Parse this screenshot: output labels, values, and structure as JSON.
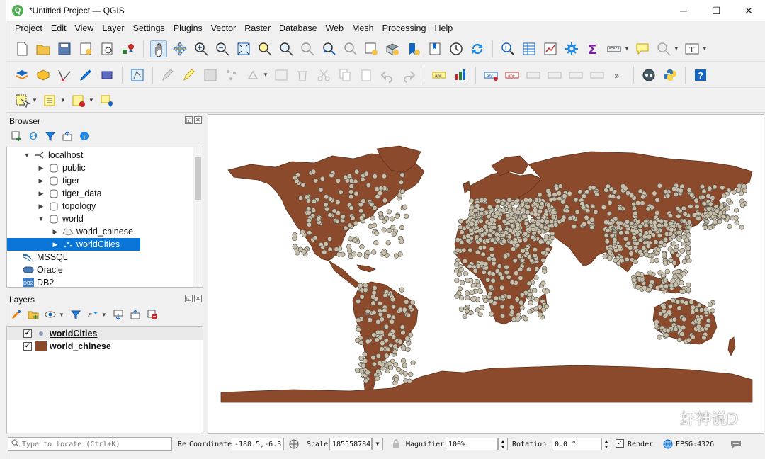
{
  "window": {
    "title": "*Untitled Project — QGIS",
    "minimize": "─",
    "maximize": "☐",
    "close": "✕"
  },
  "menu": [
    "Project",
    "Edit",
    "View",
    "Layer",
    "Settings",
    "Plugins",
    "Vector",
    "Raster",
    "Database",
    "Web",
    "Mesh",
    "Processing",
    "Help"
  ],
  "browser": {
    "title": "Browser",
    "tree": [
      {
        "label": "localhost",
        "icon": "postgres-connection-icon",
        "expanded": true
      },
      {
        "label": "public",
        "icon": "schema-icon"
      },
      {
        "label": "tiger",
        "icon": "schema-icon"
      },
      {
        "label": "tiger_data",
        "icon": "schema-icon"
      },
      {
        "label": "topology",
        "icon": "schema-icon"
      },
      {
        "label": "world",
        "icon": "schema-icon",
        "expanded": true
      },
      {
        "label": "world_chinese",
        "icon": "polygon-layer-icon"
      },
      {
        "label": "worldCities",
        "icon": "point-layer-icon",
        "selected": true
      },
      {
        "label": "MSSQL",
        "icon": "mssql-icon"
      },
      {
        "label": "Oracle",
        "icon": "oracle-icon"
      },
      {
        "label": "DB2",
        "icon": "db2-icon"
      }
    ]
  },
  "layers": {
    "title": "Layers",
    "items": [
      {
        "name": "worldCities",
        "visible": true,
        "symbol_color": "#8a9bb5"
      },
      {
        "name": "world_chinese",
        "visible": true,
        "symbol_color": "#8b4a2b"
      }
    ]
  },
  "map": {
    "land_color": "#8b4a2b",
    "city_color": "#c9bfa8",
    "watermark": "虾神说D"
  },
  "status": {
    "search_placeholder": "Type to locate (Ctrl+K)",
    "truncated_label": "Re",
    "coordinate_label": "Coordinate",
    "coordinate_value": "-188.5,-6.3",
    "scale_label": "Scale",
    "scale_value": "185558784",
    "magnifier_label": "Magnifier",
    "magnifier_value": "100%",
    "rotation_label": "Rotation",
    "rotation_value": "0.0 °",
    "render_label": "Render",
    "render_checked": true,
    "crs": "EPSG:4326"
  }
}
